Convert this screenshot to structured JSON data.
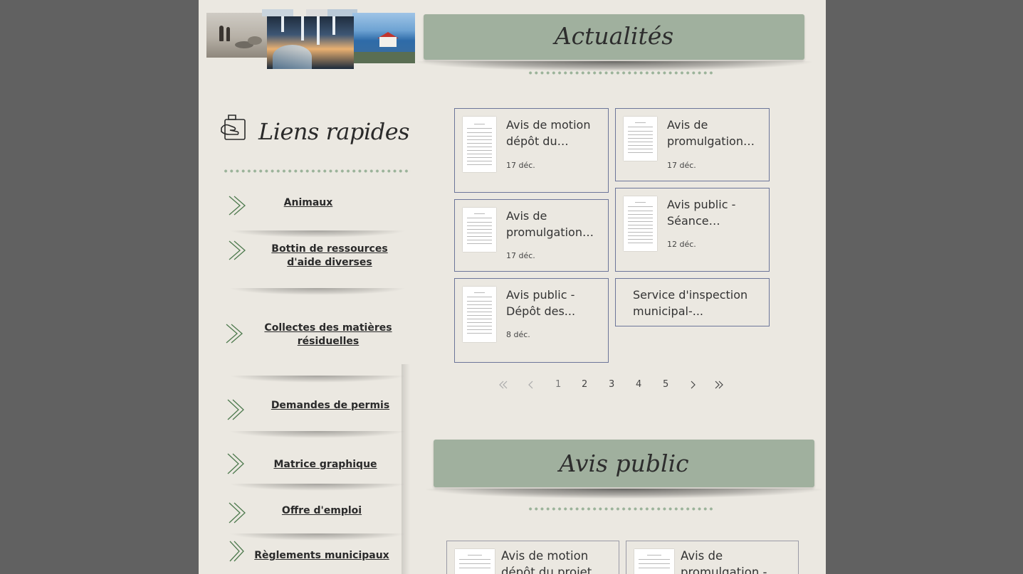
{
  "colors": {
    "page_bg": "#ebe8e1",
    "outer_bg": "#616161",
    "banner_bg": "#a0b09e",
    "dot_color": "#9bb39a",
    "card_border": "#6c7599",
    "chevron": "#4e7a4e"
  },
  "actualites": {
    "title": "Actualités",
    "cards": [
      {
        "title": "Avis de motion dépôt du proje...",
        "date": "17 déc."
      },
      {
        "title": "Avis de promulgation -...",
        "date": "17 déc."
      },
      {
        "title": "Avis de promulgation -...",
        "date": "17 déc."
      },
      {
        "title": "Avis public - Séance ordinai...",
        "date": "12 déc."
      },
      {
        "title": "Avis public - Dépôt des...",
        "date": "8 déc."
      },
      {
        "title": "Service d'inspection municipal-...",
        "date": ""
      }
    ],
    "pagination": {
      "first_icon": "double-chevron-left-icon",
      "prev_icon": "chevron-left-icon",
      "pages": [
        "1",
        "2",
        "3",
        "4",
        "5"
      ],
      "current": "1",
      "next_icon": "chevron-right-icon",
      "last_icon": "double-chevron-right-icon"
    }
  },
  "liens_rapides": {
    "title": "Liens rapides",
    "icon": "hand-clipboard-icon",
    "items": [
      {
        "label": "Animaux"
      },
      {
        "label": "Bottin de ressources d'aide diverses"
      },
      {
        "label": "Collectes des matières résiduelles"
      },
      {
        "label": "Demandes de permis"
      },
      {
        "label": "Matrice graphique"
      },
      {
        "label": "Offre d'emploi"
      },
      {
        "label": "Règlements municipaux"
      }
    ]
  },
  "avis_public": {
    "title": "Avis public",
    "cards": [
      {
        "title": "Avis de motion dépôt du projet de"
      },
      {
        "title": "Avis de promulgation -"
      }
    ]
  }
}
